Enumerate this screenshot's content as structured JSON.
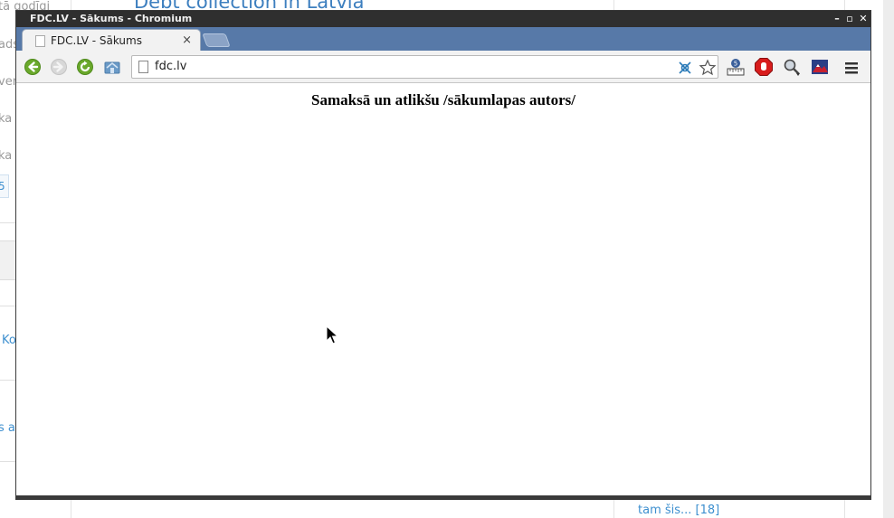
{
  "background": {
    "heading": "Debt collection in Latvia",
    "fragments": [
      "tā godīgi",
      "ads",
      "ven",
      "ka",
      "ka d",
      "Ko",
      "s a"
    ],
    "pager_value": "5",
    "side_link": "tam šis... [18]"
  },
  "window": {
    "title": "FDC.LV - Sākums - Chromium",
    "minimize": "–",
    "maximize": "▫",
    "close": "✕"
  },
  "tabs": [
    {
      "label": "FDC.LV - Sākums",
      "close": "×"
    }
  ],
  "toolbar": {
    "url": "fdc.lv",
    "icons": [
      "back-icon",
      "forward-icon",
      "reload-icon",
      "home-icon"
    ],
    "omnibox_icons": [
      "translate-icon",
      "bookmark-star-icon"
    ],
    "extensions": [
      "ruler-extension-icon",
      "adblock-icon",
      "magnifier-extension-icon",
      "mountain-extension-icon"
    ],
    "menu": "chrome-menu-icon"
  },
  "page": {
    "title": "Samaksā un atlikšu /sākumlapas autors/"
  },
  "colors": {
    "tabstrip": "#5779a8",
    "titlebar": "#2f2f2f",
    "link": "#3d8fcf",
    "nav_green": "#6aa82b"
  }
}
